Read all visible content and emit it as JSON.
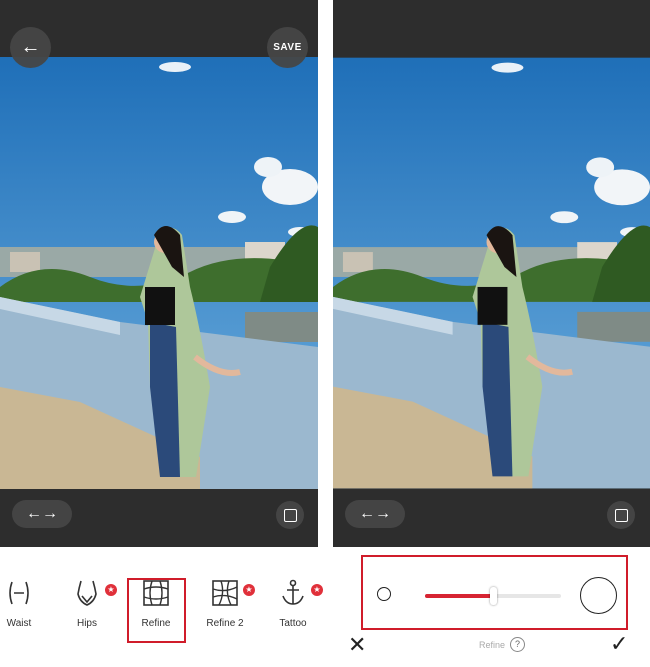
{
  "left": {
    "back_icon": "←",
    "save_label": "SAVE",
    "compare_icon": "←→",
    "split_icon": "compare-split-icon"
  },
  "tools": [
    {
      "label": "Waist",
      "icon": "waist-icon",
      "badge": false
    },
    {
      "label": "Hips",
      "icon": "hips-icon",
      "badge": true
    },
    {
      "label": "Refine",
      "icon": "refine-grid-icon",
      "badge": false,
      "selected": true
    },
    {
      "label": "Refine 2",
      "icon": "refine-2-icon",
      "badge": true
    },
    {
      "label": "Tattoo",
      "icon": "anchor-icon",
      "badge": true
    }
  ],
  "badge_glyph": "★",
  "right": {
    "compare_icon": "←→",
    "split_icon": "compare-split-icon",
    "brush_slider": {
      "value_fraction": 0.5
    },
    "tool_name": "Refine",
    "help_glyph": "?",
    "cancel_glyph": "✕",
    "confirm_glyph": "✓"
  },
  "colors": {
    "accent": "#d72432",
    "highlight": "#d01c2a",
    "editor_bg": "#2d2d2d"
  }
}
